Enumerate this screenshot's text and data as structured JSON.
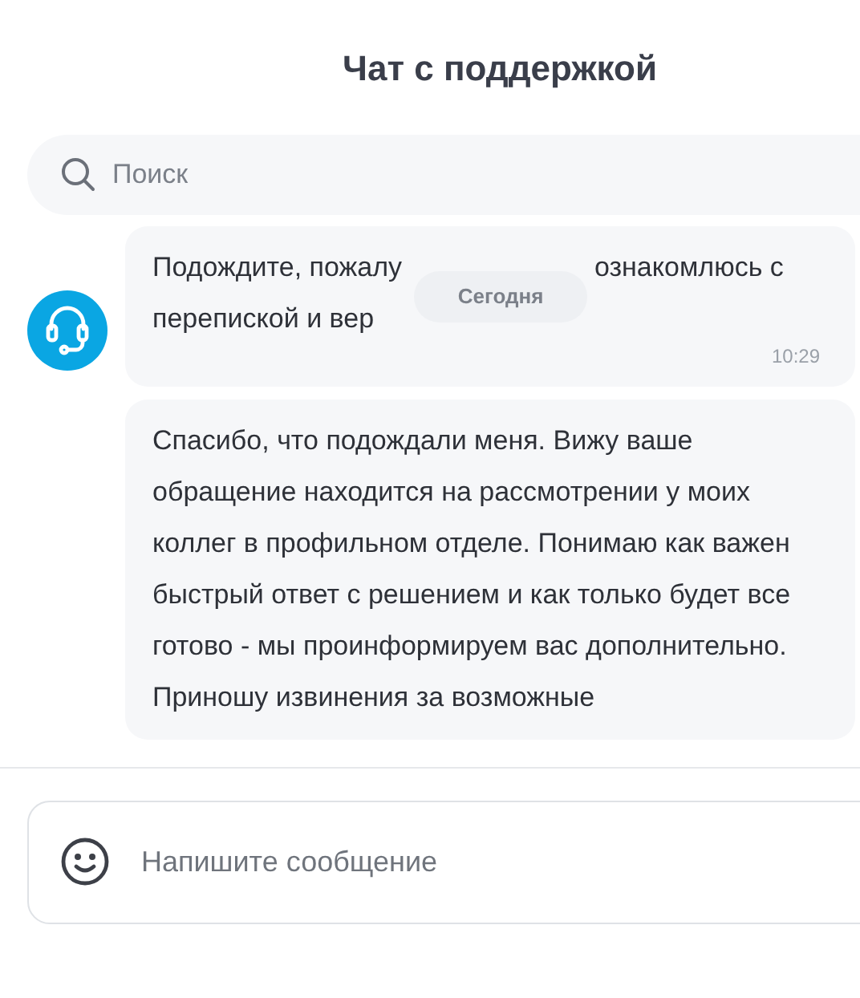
{
  "header": {
    "title": "Чат с поддержкой"
  },
  "search": {
    "placeholder": "Поиск"
  },
  "date_badge": "Сегодня",
  "messages": [
    {
      "kind": "agent",
      "text_parts": [
        "Подождите, пожалу",
        "ознакомлюсь с",
        "перепиской и вер"
      ],
      "time": "10:29"
    },
    {
      "kind": "plain",
      "text": "Спасибо, что подождали меня. Вижу ваше обращение находится на рассмотрении у моих коллег в профильном отделе. Понимаю как важен быстрый ответ с решением и как только будет все готово - мы проинформируем вас дополнительно. Приношу извинения за возможные"
    }
  ],
  "composer": {
    "placeholder": "Напишите сообщение"
  }
}
